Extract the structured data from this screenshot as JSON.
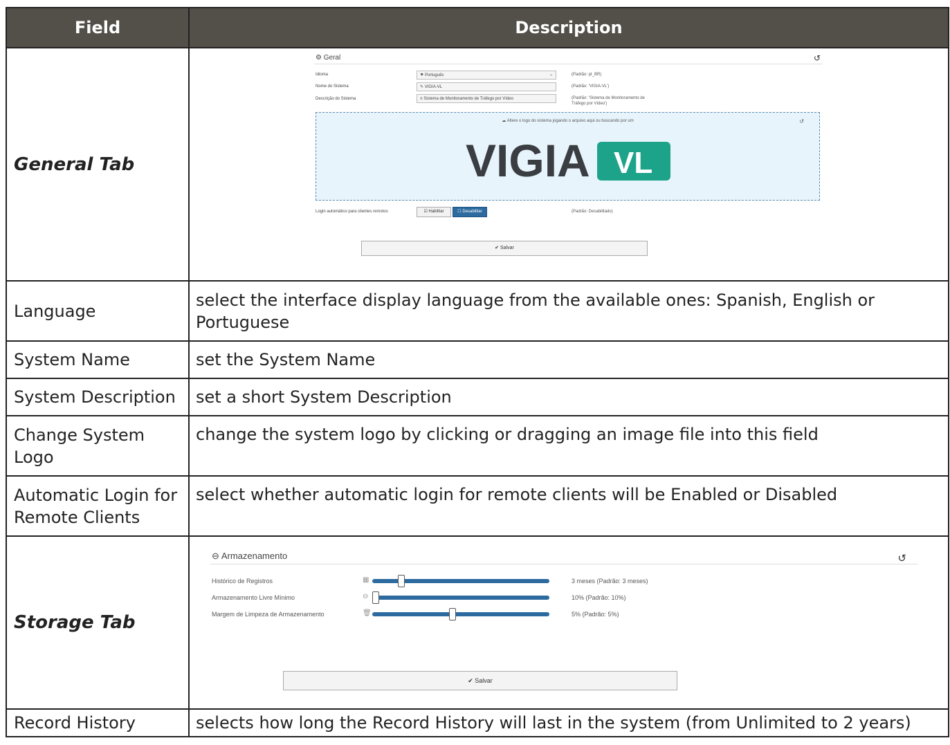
{
  "header": {
    "field": "Field",
    "description": "Description"
  },
  "general": {
    "title": "General Tab",
    "panel": {
      "heading": "Geral",
      "rows": [
        {
          "label": "Idioma",
          "value": "Português",
          "hint": "(Padrão: pt_BR)"
        },
        {
          "label": "Nome do Sistema",
          "value": "VIGIA-VL",
          "hint": "(Padrão: 'VIGIA-VL')"
        },
        {
          "label": "Descrição do Sistema",
          "value": "Sistema de Monitoramento de Tráfego por Vídeo",
          "hint": "(Padrão: 'Sistema de Monitoramento de Tráfego por Vídeo')"
        }
      ],
      "drop_text": "Altere o logo do sistema jogando o arquivo aqui ou buscando por um",
      "logo_word": "VIGIA",
      "logo_badge": "VL",
      "logo_dark": "#3a3d42",
      "logo_accent": "#1da38a",
      "login_label": "Login automático para clientes remotos",
      "enable_label": "Habilitar",
      "disable_label": "Desabilitar",
      "login_hint": "(Padrão: Desabilitado)",
      "save_label": "Salvar"
    }
  },
  "rows": [
    {
      "field": "Language",
      "description": "select the interface display language from the available ones: Spanish, English or Portuguese"
    },
    {
      "field": "System Name",
      "description": "set the System Name"
    },
    {
      "field": "System Description",
      "description": "set a short System Description"
    },
    {
      "field": "Change System Logo",
      "description": "change the system logo by clicking or dragging an image file into this field"
    },
    {
      "field": "Automatic Login for Remote Clients",
      "description": "select whether automatic login for remote clients will be Enabled or Disabled"
    }
  ],
  "storage": {
    "title": "Storage Tab",
    "panel": {
      "heading": "Armazenamento",
      "sliders": [
        {
          "label": "Histórico de Registros",
          "value": "3 meses  (Padrão: 3 meses)",
          "level": 0.15,
          "icon": "calendar-icon"
        },
        {
          "label": "Armazenamento Livre Mínimo",
          "value": "10%  (Padrão: 10%)",
          "level": 0.0,
          "icon": "drive-icon"
        },
        {
          "label": "Margem de Limpeza de Armazenamento",
          "value": "5%  (Padrão: 5%)",
          "level": 0.45,
          "icon": "trash-icon"
        }
      ],
      "save_label": "Salvar"
    }
  },
  "last_row": {
    "field": "Record History",
    "description": "selects how long the Record History will last in the system (from Unlimited to 2 years)"
  }
}
